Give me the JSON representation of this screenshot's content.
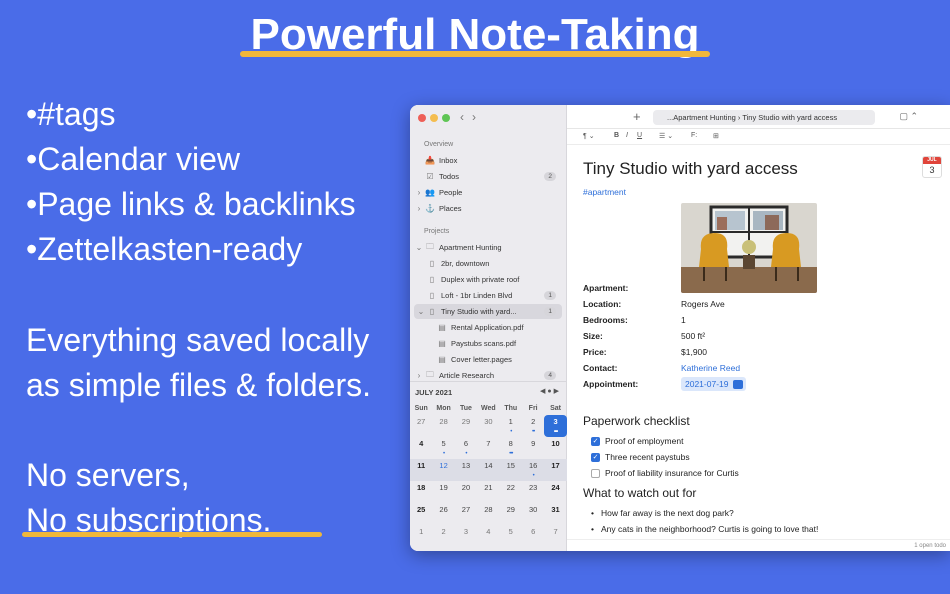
{
  "promo": {
    "headline": "Powerful Note-Taking",
    "bullets": [
      "•#tags",
      "•Calendar view",
      "•Page links & backlinks",
      "•Zettelkasten-ready"
    ],
    "local_line1": "Everything saved locally",
    "local_line2": "as simple files & folders.",
    "servers": "No servers,",
    "subscriptions": "No subscriptions.",
    "accent_color": "#f0b73a",
    "background_color": "#4a6ce8"
  },
  "sidebar": {
    "overview_label": "Overview",
    "overview_items": [
      {
        "label": "Inbox",
        "icon": "inbox-icon",
        "badge": ""
      },
      {
        "label": "Todos",
        "icon": "checkbox-icon",
        "badge": "2"
      },
      {
        "label": "People",
        "icon": "people-icon",
        "badge": ""
      },
      {
        "label": "Places",
        "icon": "pin-icon",
        "badge": ""
      }
    ],
    "projects_label": "Projects",
    "project_items": [
      {
        "label": "Apartment Hunting",
        "badge": ""
      },
      {
        "label": "2br, downtown",
        "badge": ""
      },
      {
        "label": "Duplex with private roof",
        "badge": ""
      },
      {
        "label": "Loft - 1br Linden Blvd",
        "badge": "1"
      },
      {
        "label": "Tiny Studio with yard...",
        "badge": "1"
      },
      {
        "label": "Rental Application.pdf",
        "badge": ""
      },
      {
        "label": "Paystubs scans.pdf",
        "badge": ""
      },
      {
        "label": "Cover letter.pages",
        "badge": ""
      },
      {
        "label": "Article Research",
        "badge": "4"
      }
    ]
  },
  "calendar": {
    "month": "JULY 2021",
    "weekdays": [
      "Sun",
      "Mon",
      "Tue",
      "Wed",
      "Thu",
      "Fri",
      "Sat"
    ],
    "days": [
      [
        "27",
        "28",
        "29",
        "30",
        "1",
        "2",
        "3"
      ],
      [
        "4",
        "5",
        "6",
        "7",
        "8",
        "9",
        "10"
      ],
      [
        "11",
        "12",
        "13",
        "14",
        "15",
        "16",
        "17"
      ],
      [
        "18",
        "19",
        "20",
        "21",
        "22",
        "23",
        "24"
      ],
      [
        "25",
        "26",
        "27",
        "28",
        "29",
        "30",
        "31"
      ],
      [
        "1",
        "2",
        "3",
        "4",
        "5",
        "6",
        "7"
      ]
    ]
  },
  "toolbar": {
    "path": "...Apartment Hunting  ›  Tiny Studio with yard access",
    "format_paragraph": "¶ ⌄",
    "format_bold": "B",
    "format_italic": "I",
    "format_underline": "U",
    "format_list": "☰ ⌄",
    "format_font": "F:",
    "format_table": "⊞"
  },
  "note": {
    "title": "Tiny Studio with yard access",
    "tag": "#apartment",
    "cal_badge_month": "JUL",
    "cal_badge_day": "3",
    "fields": [
      {
        "key": "Apartment:",
        "value": ""
      },
      {
        "key": "Location:",
        "value": "Rogers Ave"
      },
      {
        "key": "Bedrooms:",
        "value": "1"
      },
      {
        "key": "Size:",
        "value": "500 ft²"
      },
      {
        "key": "Price:",
        "value": "$1,900"
      },
      {
        "key": "Contact:",
        "value": "Katherine Reed"
      },
      {
        "key": "Appointment:",
        "value": "2021-07-19"
      }
    ],
    "checklist_heading": "Paperwork checklist",
    "checklist": [
      {
        "label": "Proof of employment",
        "checked": true
      },
      {
        "label": "Three recent paystubs",
        "checked": true
      },
      {
        "label": "Proof of liability insurance for Curtis",
        "checked": false
      }
    ],
    "watch_heading": "What to watch out for",
    "watch_items": [
      "How far away is the next dog park?",
      "Any cats in the neighborhood? Curtis is going to love that!"
    ],
    "status": "1 open todo"
  }
}
